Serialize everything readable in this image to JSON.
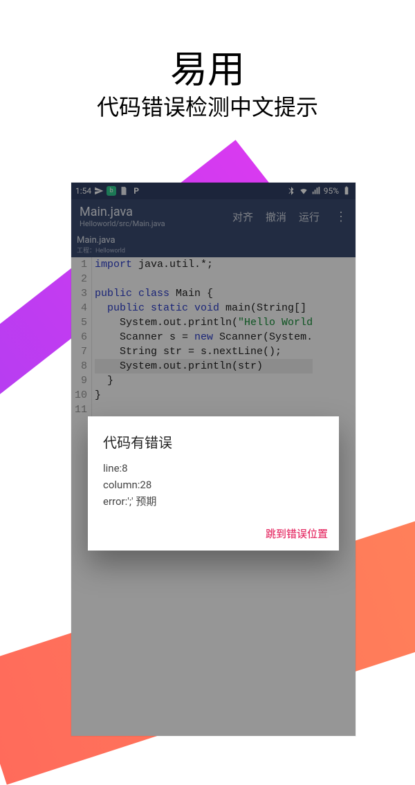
{
  "marketing": {
    "title": "易用",
    "subtitle": "代码错误检测中文提示"
  },
  "statusbar": {
    "time": "1:54",
    "battery_text": "95%",
    "icons": [
      "send",
      "green-badge",
      "file-badge",
      "p-badge"
    ],
    "right_icons": [
      "bluetooth",
      "wifi",
      "signal"
    ]
  },
  "appbar": {
    "title": "Main.java",
    "subtitle": "Helloworld/src/Main.java",
    "actions": [
      "对齐",
      "撤消",
      "运行"
    ],
    "menu_glyph": "⋮"
  },
  "tab": {
    "name": "Main.java",
    "project": "工程：Helloworld"
  },
  "code": {
    "line_count": 11,
    "highlighted_line": 8,
    "lines": [
      {
        "n": 1,
        "segs": [
          {
            "t": "import ",
            "c": "kw"
          },
          {
            "t": "java.util.",
            "c": "pkg"
          },
          {
            "t": "*",
            "c": "cls"
          },
          {
            "t": ";",
            "c": "cls"
          }
        ]
      },
      {
        "n": 2,
        "segs": []
      },
      {
        "n": 3,
        "segs": [
          {
            "t": "public class ",
            "c": "kw"
          },
          {
            "t": "Main {",
            "c": "cls"
          }
        ]
      },
      {
        "n": 4,
        "segs": [
          {
            "t": "  ",
            "c": ""
          },
          {
            "t": "public static void ",
            "c": "kw"
          },
          {
            "t": "main(String[]",
            "c": "cls"
          }
        ]
      },
      {
        "n": 5,
        "segs": [
          {
            "t": "    System.out.println(",
            "c": "cls"
          },
          {
            "t": "\"Hello World",
            "c": "str"
          }
        ]
      },
      {
        "n": 6,
        "segs": [
          {
            "t": "    Scanner s = ",
            "c": "cls"
          },
          {
            "t": "new ",
            "c": "kw"
          },
          {
            "t": "Scanner(System.",
            "c": "cls"
          }
        ]
      },
      {
        "n": 7,
        "segs": [
          {
            "t": "    String str = s.nextLine();",
            "c": "cls"
          }
        ]
      },
      {
        "n": 8,
        "segs": [
          {
            "t": "    System.out.println(str)",
            "c": "cls"
          }
        ]
      },
      {
        "n": 9,
        "segs": [
          {
            "t": "  }",
            "c": "cls"
          }
        ]
      },
      {
        "n": 10,
        "segs": [
          {
            "t": "}",
            "c": "cls"
          }
        ]
      },
      {
        "n": 11,
        "segs": []
      }
    ]
  },
  "dialog": {
    "title": "代码有错误",
    "lines": [
      "line:8",
      "column:28",
      "error:';' 预期"
    ],
    "button": "跳到错误位置"
  }
}
